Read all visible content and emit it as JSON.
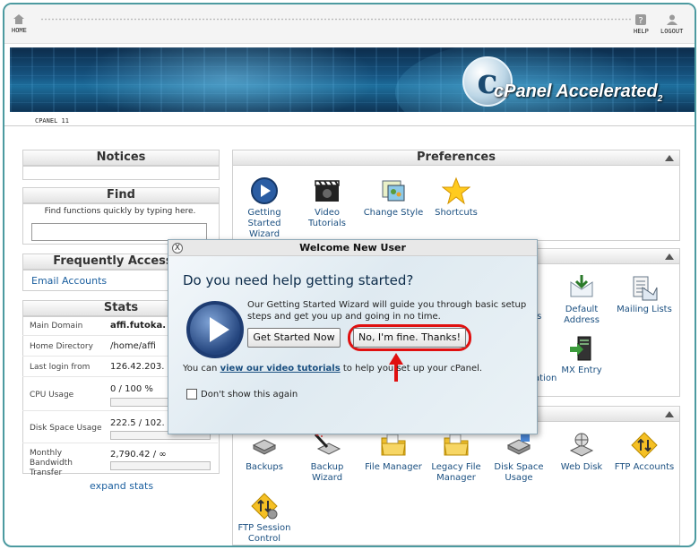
{
  "topbar": {
    "home_label": "HOME",
    "help_label": "HELP",
    "logout_label": "LOGOUT"
  },
  "banner": {
    "brand": "cPanel",
    "brand_tail": "Accelerated",
    "brand_sub": "2"
  },
  "subbar": {
    "label": "CPANEL 11"
  },
  "notices": {
    "title": "Notices"
  },
  "find": {
    "title": "Find",
    "hint": "Find functions quickly by typing here.",
    "value": ""
  },
  "frequent": {
    "title": "Frequently Accessed",
    "items": [
      "Email Accounts"
    ]
  },
  "stats": {
    "title": "Stats",
    "rows": [
      {
        "label": "Main Domain",
        "value": "affi.futoka."
      },
      {
        "label": "Home Directory",
        "value": "/home/affi"
      },
      {
        "label": "Last login from",
        "value": "126.42.203."
      },
      {
        "label": "CPU Usage",
        "value": "0 / 100 %"
      },
      {
        "label": "Disk Space Usage",
        "value": "222.5 / 102."
      },
      {
        "label": "Monthly Bandwidth Transfer",
        "value": "2,790.42 / ∞"
      }
    ],
    "expand": "expand stats"
  },
  "preferences": {
    "title": "Preferences",
    "items": [
      {
        "label": "Getting Started Wizard",
        "icon": "play-circle-icon"
      },
      {
        "label": "Video Tutorials",
        "icon": "clapperboard-icon"
      },
      {
        "label": "Change Style",
        "icon": "palette-icon"
      },
      {
        "label": "Shortcuts",
        "icon": "star-icon"
      }
    ]
  },
  "mail": {
    "visible_labels": [
      "rs",
      "Default Address",
      "Mailing Lists",
      "ation",
      "MX Entry"
    ]
  },
  "files": {
    "items": [
      {
        "label": "Backups"
      },
      {
        "label": "Backup Wizard"
      },
      {
        "label": "File Manager"
      },
      {
        "label": "Legacy File Manager"
      },
      {
        "label": "Disk Space Usage"
      },
      {
        "label": "Web Disk"
      },
      {
        "label": "FTP Accounts"
      },
      {
        "label": "FTP Session Control"
      }
    ]
  },
  "modal": {
    "title": "Welcome New User",
    "heading": "Do you need help getting started?",
    "description": "Our Getting Started Wizard will guide you through basic setup steps and get you up and going in no time.",
    "start_button": "Get Started Now",
    "decline_button": "No, I'm fine. Thanks!",
    "foot_prefix": "You can ",
    "foot_link": "view our video tutorials",
    "foot_suffix": " to help you set up your cPanel.",
    "dont_show": "Don't show this again",
    "close_glyph": "X"
  },
  "colors": {
    "accent": "#e01010",
    "link": "#1a4f80",
    "frame": "#4c9aa0"
  }
}
